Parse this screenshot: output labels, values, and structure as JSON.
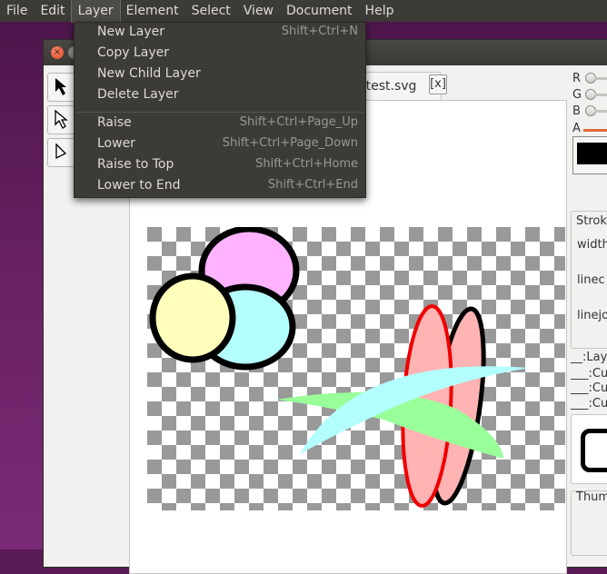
{
  "menubar": {
    "items": [
      "File",
      "Edit",
      "Layer",
      "Element",
      "Select",
      "View",
      "Document",
      "Help"
    ],
    "active": "Layer"
  },
  "window": {
    "close_glyph": "×",
    "minimize_glyph": "–"
  },
  "tab": {
    "label": "e_test.svg",
    "close_label": "[x]"
  },
  "layer_menu": {
    "items": [
      {
        "label": "New Layer",
        "shortcut": "Shift+Ctrl+N"
      },
      {
        "label": "Copy Layer",
        "shortcut": ""
      },
      {
        "label": "New Child Layer",
        "shortcut": ""
      },
      {
        "label": "Delete Layer",
        "shortcut": ""
      },
      {
        "label": "Raise",
        "shortcut": "Shift+Ctrl+Page_Up"
      },
      {
        "label": "Lower",
        "shortcut": "Shift+Ctrl+Page_Down"
      },
      {
        "label": "Raise to Top",
        "shortcut": "Shift+Ctrl+Home"
      },
      {
        "label": "Lower to End",
        "shortcut": "Shift+Ctrl+End"
      }
    ]
  },
  "color_panel": {
    "r_label": "R",
    "g_label": "G",
    "b_label": "B",
    "a_label": "A",
    "current_color": "#000000"
  },
  "stroke_panel": {
    "title": "Strok",
    "width_label": "width",
    "linecap_label": "linec",
    "linejoin_label": "linejo"
  },
  "layers_list": {
    "items": [
      "__:Lay",
      "___:Cu",
      "___:Cu",
      "___:Cu"
    ]
  },
  "thumbnail_panel": {
    "title": "Thum"
  },
  "colors": {
    "menubar_bg": "#3c3b37",
    "menu_text": "#dfdbd2",
    "accent": "#e06a3a"
  }
}
